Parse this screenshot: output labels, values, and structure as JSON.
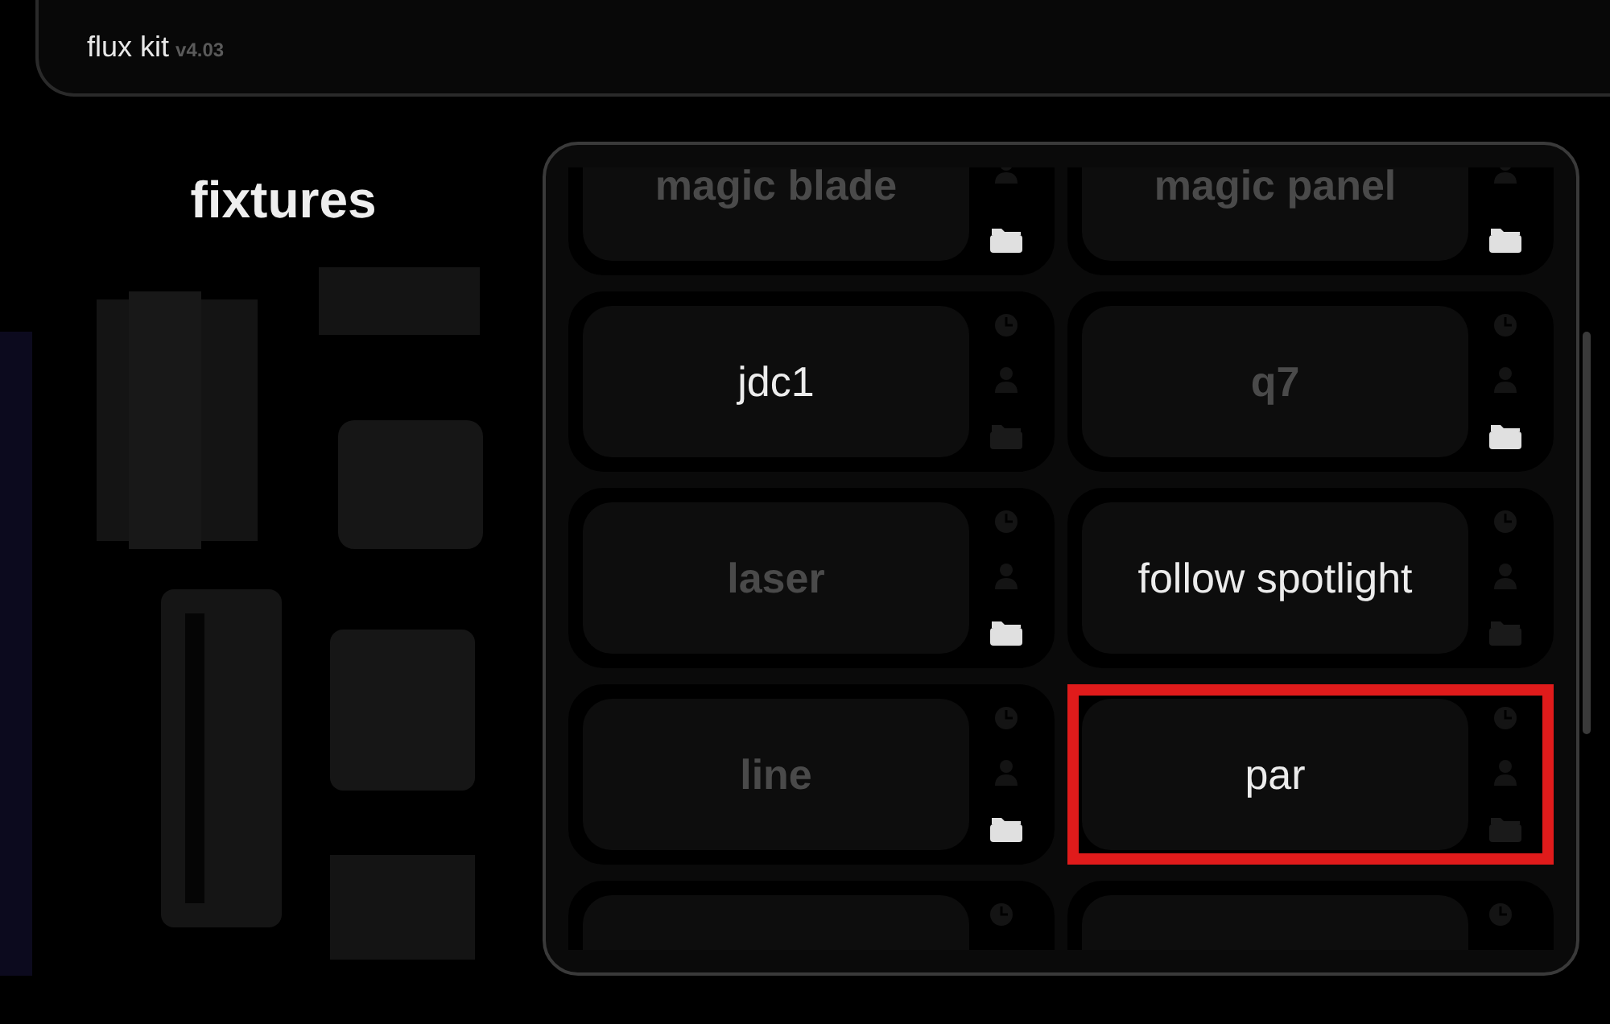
{
  "header": {
    "title": "flux kit",
    "version": "v4.03"
  },
  "sidebar": {
    "title": "fixtures"
  },
  "fixtures": [
    {
      "label": "magic blade",
      "enabled": false,
      "selected": false
    },
    {
      "label": "magic panel",
      "enabled": false,
      "selected": false
    },
    {
      "label": "jdc1",
      "enabled": true,
      "selected": false
    },
    {
      "label": "q7",
      "enabled": false,
      "selected": false
    },
    {
      "label": "laser",
      "enabled": false,
      "selected": false
    },
    {
      "label": "follow spotlight",
      "enabled": true,
      "selected": false
    },
    {
      "label": "line",
      "enabled": false,
      "selected": false
    },
    {
      "label": "par",
      "enabled": true,
      "selected": true
    },
    {
      "selected": false
    },
    {
      "selected": false
    }
  ]
}
